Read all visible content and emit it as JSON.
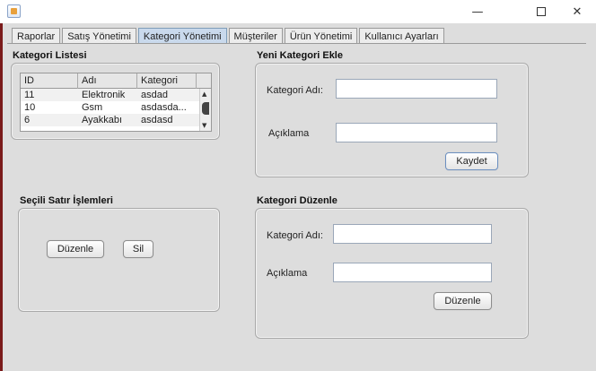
{
  "window": {
    "icon": "java-window-icon",
    "controls": {
      "minimize": "—",
      "maximize": "□",
      "close": "✕"
    }
  },
  "tabs": [
    {
      "label": "Raporlar",
      "active": false
    },
    {
      "label": "Satış Yönetimi",
      "active": false
    },
    {
      "label": "Kategori Yönetimi",
      "active": true
    },
    {
      "label": "Müşteriler",
      "active": false
    },
    {
      "label": "Ürün Yönetimi",
      "active": false
    },
    {
      "label": "Kullanıcı Ayarları",
      "active": false
    }
  ],
  "category_list": {
    "title": "Kategori Listesi",
    "columns": [
      "ID",
      "Adı",
      "Kategori"
    ],
    "rows": [
      [
        "11",
        "Elektronik",
        "asdad"
      ],
      [
        "10",
        "Gsm",
        "asdasda..."
      ],
      [
        "6",
        "Ayakkabı",
        "asdasd"
      ]
    ]
  },
  "new_category": {
    "title": "Yeni Kategori Ekle",
    "name_label": "Kategori Adı:",
    "name_value": "",
    "description_label": "Açıklama",
    "description_value": "",
    "save_button": "Kaydet"
  },
  "selected_row": {
    "title": "Seçili Satır İşlemleri",
    "edit_button": "Düzenle",
    "delete_button": "Sil"
  },
  "edit_category": {
    "title": "Kategori Düzenle",
    "name_label": "Kategori Adı:",
    "name_value": "",
    "description_label": "Açıklama",
    "description_value": "",
    "edit_button": "Düzenle"
  },
  "colors": {
    "panel_background": "#dddddd",
    "active_tab": "#c9d9ec",
    "left_stripe": "#7a1a1a"
  }
}
